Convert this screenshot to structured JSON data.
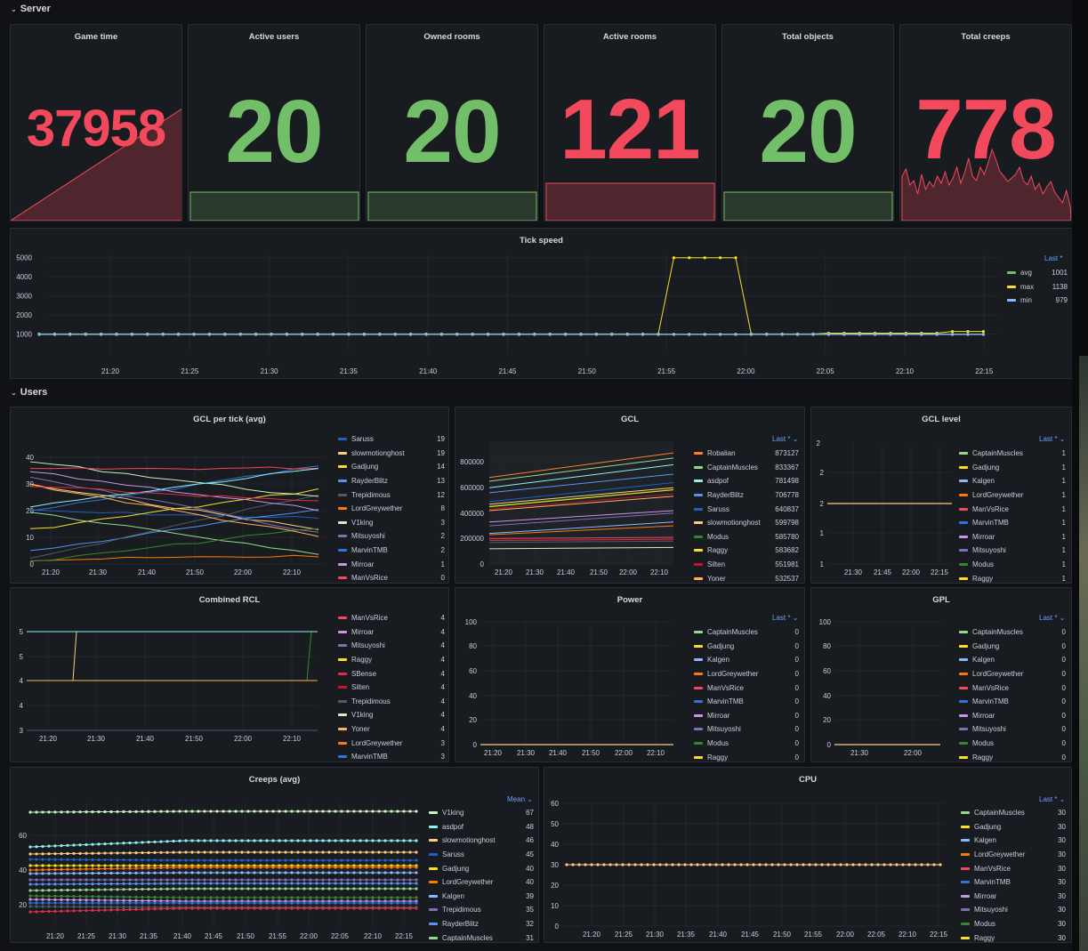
{
  "rows": {
    "server": "Server",
    "users": "Users"
  },
  "colors": {
    "red": "#f2495c",
    "green": "#73bf69",
    "bg": "#181b1f"
  },
  "stats": [
    {
      "title": "Game time",
      "value": "37958",
      "color": "red"
    },
    {
      "title": "Active users",
      "value": "20",
      "color": "green"
    },
    {
      "title": "Owned rooms",
      "value": "20",
      "color": "green"
    },
    {
      "title": "Active rooms",
      "value": "121",
      "color": "red"
    },
    {
      "title": "Total objects",
      "value": "20",
      "color": "green"
    },
    {
      "title": "Total creeps",
      "value": "778",
      "color": "red"
    }
  ],
  "panels": {
    "tick": "Tick speed",
    "gcl_tick": "GCL per tick (avg)",
    "gcl": "GCL",
    "gcl_level": "GCL level",
    "rcl": "Combined RCL",
    "power": "Power",
    "gpl": "GPL",
    "creeps": "Creeps (avg)",
    "cpu": "CPU"
  },
  "legend_headers": {
    "last": "Last *",
    "mean": "Mean"
  },
  "legends": {
    "tick": [
      [
        "avg",
        "1001",
        "#73bf69"
      ],
      [
        "max",
        "1138",
        "#fade2a"
      ],
      [
        "min",
        "979",
        "#8ab8ff"
      ]
    ],
    "gcl_tick": [
      [
        "Saruss",
        "19",
        "#1f60c4"
      ],
      [
        "slowmotionghost",
        "19",
        "#ffcb7d"
      ],
      [
        "Gadjung",
        "14",
        "#fade2a"
      ],
      [
        "RayderBlitz",
        "13",
        "#5794f2"
      ],
      [
        "Trepidimous",
        "12",
        "#4f5a6b"
      ],
      [
        "LordGreywether",
        "8",
        "#ff780a"
      ],
      [
        "V1king",
        "3",
        "#c8f2c2"
      ],
      [
        "Mitsuyoshi",
        "2",
        "#806eb7"
      ],
      [
        "MarvinTMB",
        "2",
        "#3274d9"
      ],
      [
        "Mirroar",
        "1",
        "#ca95e5"
      ],
      [
        "ManVsRice",
        "0",
        "#f2495c"
      ]
    ],
    "gcl": [
      [
        "Robalian",
        "873127",
        "#ff7f2a"
      ],
      [
        "CaptainMuscles",
        "833367",
        "#96d98d"
      ],
      [
        "asdpof",
        "781498",
        "#8ff0f2"
      ],
      [
        "RayderBlitz",
        "706778",
        "#5794f2"
      ],
      [
        "Saruss",
        "640837",
        "#1f60c4"
      ],
      [
        "slowmotionghost",
        "599798",
        "#ffcb7d"
      ],
      [
        "Modus",
        "585780",
        "#37872d"
      ],
      [
        "Raggy",
        "583682",
        "#fade2a"
      ],
      [
        "Silten",
        "551981",
        "#c4162a"
      ],
      [
        "Yoner",
        "532537",
        "#ffb357"
      ]
    ],
    "gcl_level": [
      [
        "CaptainMuscles",
        "1",
        "#96d98d"
      ],
      [
        "Gadjung",
        "1",
        "#fade2a"
      ],
      [
        "Kalgen",
        "1",
        "#8ab8ff"
      ],
      [
        "LordGreywether",
        "1",
        "#ff780a"
      ],
      [
        "ManVsRice",
        "1",
        "#f2495c"
      ],
      [
        "MarvinTMB",
        "1",
        "#3274d9"
      ],
      [
        "Mirroar",
        "1",
        "#ca95e5"
      ],
      [
        "Mitsuyoshi",
        "1",
        "#806eb7"
      ],
      [
        "Modus",
        "1",
        "#37872d"
      ],
      [
        "Raggy",
        "1",
        "#fade2a"
      ]
    ],
    "rcl": [
      [
        "ManVsRice",
        "4",
        "#f2495c"
      ],
      [
        "Mirroar",
        "4",
        "#ca95e5"
      ],
      [
        "Mitsuyoshi",
        "4",
        "#806eb7"
      ],
      [
        "Raggy",
        "4",
        "#fade2a"
      ],
      [
        "SBense",
        "4",
        "#e02f44"
      ],
      [
        "Silten",
        "4",
        "#c4162a"
      ],
      [
        "Trepidimous",
        "4",
        "#4f5a6b"
      ],
      [
        "V1king",
        "4",
        "#c8f2c2"
      ],
      [
        "Yoner",
        "4",
        "#ffb357"
      ],
      [
        "LordGreywether",
        "3",
        "#ff780a"
      ],
      [
        "MarvinTMB",
        "3",
        "#3274d9"
      ]
    ],
    "power": [
      [
        "CaptainMuscles",
        "0",
        "#96d98d"
      ],
      [
        "Gadjung",
        "0",
        "#fade2a"
      ],
      [
        "Kalgen",
        "0",
        "#8ab8ff"
      ],
      [
        "LordGreywether",
        "0",
        "#ff780a"
      ],
      [
        "ManVsRice",
        "0",
        "#f2495c"
      ],
      [
        "MarvinTMB",
        "0",
        "#3274d9"
      ],
      [
        "Mirroar",
        "0",
        "#ca95e5"
      ],
      [
        "Mitsuyoshi",
        "0",
        "#806eb7"
      ],
      [
        "Modus",
        "0",
        "#37872d"
      ],
      [
        "Raggy",
        "0",
        "#fade2a"
      ]
    ],
    "gpl": [
      [
        "CaptainMuscles",
        "0",
        "#96d98d"
      ],
      [
        "Gadjung",
        "0",
        "#fade2a"
      ],
      [
        "Kalgen",
        "0",
        "#8ab8ff"
      ],
      [
        "LordGreywether",
        "0",
        "#ff780a"
      ],
      [
        "ManVsRice",
        "0",
        "#f2495c"
      ],
      [
        "MarvinTMB",
        "0",
        "#3274d9"
      ],
      [
        "Mirroar",
        "0",
        "#ca95e5"
      ],
      [
        "Mitsuyoshi",
        "0",
        "#806eb7"
      ],
      [
        "Modus",
        "0",
        "#37872d"
      ],
      [
        "Raggy",
        "0",
        "#fade2a"
      ]
    ],
    "creeps": [
      [
        "V1king",
        "67",
        "#c8f2c2"
      ],
      [
        "asdpof",
        "48",
        "#8ff0f2"
      ],
      [
        "slowmotionghost",
        "46",
        "#ffcb7d"
      ],
      [
        "Saruss",
        "45",
        "#1f60c4"
      ],
      [
        "Gadjung",
        "40",
        "#fade2a"
      ],
      [
        "LordGreywether",
        "40",
        "#ff780a"
      ],
      [
        "Kalgen",
        "39",
        "#8ab8ff"
      ],
      [
        "Trepidimous",
        "35",
        "#806eb7"
      ],
      [
        "RayderBlitz",
        "32",
        "#5794f2"
      ],
      [
        "CaptainMuscles",
        "31",
        "#96d98d"
      ]
    ],
    "cpu": [
      [
        "CaptainMuscles",
        "30",
        "#96d98d"
      ],
      [
        "Gadjung",
        "30",
        "#fade2a"
      ],
      [
        "Kalgen",
        "30",
        "#8ab8ff"
      ],
      [
        "LordGreywether",
        "30",
        "#ff780a"
      ],
      [
        "ManVsRice",
        "30",
        "#f2495c"
      ],
      [
        "MarvinTMB",
        "30",
        "#3274d9"
      ],
      [
        "Mirroar",
        "30",
        "#ca95e5"
      ],
      [
        "Mitsuyoshi",
        "30",
        "#806eb7"
      ],
      [
        "Modus",
        "30",
        "#37872d"
      ],
      [
        "Raggy",
        "30",
        "#fade2a"
      ]
    ]
  },
  "chart_data": [
    {
      "type": "line",
      "title": "Tick speed",
      "x": [
        "21:20",
        "21:25",
        "21:30",
        "21:35",
        "21:40",
        "21:45",
        "21:50",
        "21:55",
        "22:00",
        "22:05",
        "22:10",
        "22:15"
      ],
      "ylim": [
        0,
        5500
      ],
      "yticks": [
        1000,
        2000,
        3000,
        4000,
        5000
      ],
      "series": [
        {
          "name": "avg",
          "values": [
            1000,
            1000,
            1000,
            1000,
            1000,
            1000,
            1000,
            1000,
            1000,
            1000,
            1000,
            1001
          ]
        },
        {
          "name": "max",
          "values": [
            1020,
            1020,
            1010,
            1010,
            1010,
            1010,
            1010,
            5000,
            1010,
            1060,
            1060,
            1138
          ]
        },
        {
          "name": "min",
          "values": [
            979,
            979,
            979,
            979,
            979,
            979,
            979,
            979,
            979,
            979,
            979,
            979
          ]
        }
      ]
    },
    {
      "type": "line",
      "title": "GCL per tick (avg)",
      "x": [
        "21:20",
        "21:30",
        "21:40",
        "21:50",
        "22:00",
        "22:10"
      ],
      "yticks": [
        0,
        10,
        20,
        30,
        40
      ]
    },
    {
      "type": "line",
      "title": "GCL",
      "x": [
        "21:20",
        "21:30",
        "21:40",
        "21:50",
        "22:00",
        "22:10"
      ],
      "yticks": [
        0,
        200000,
        400000,
        600000,
        800000
      ]
    },
    {
      "type": "line",
      "title": "GCL level",
      "x": [
        "21:30",
        "21:45",
        "22:00",
        "22:15"
      ],
      "yticks": [
        1,
        1,
        2,
        2
      ],
      "values": [
        1,
        1,
        1,
        1
      ]
    },
    {
      "type": "line",
      "title": "Combined RCL",
      "x": [
        "21:20",
        "21:30",
        "21:40",
        "21:50",
        "22:00",
        "22:10"
      ],
      "yticks": [
        3,
        4,
        4,
        5,
        5
      ]
    },
    {
      "type": "line",
      "title": "Power",
      "x": [
        "21:20",
        "21:30",
        "21:40",
        "21:50",
        "22:00",
        "22:10"
      ],
      "yticks": [
        0,
        20,
        40,
        60,
        80,
        100
      ],
      "values": [
        0,
        0,
        0,
        0,
        0,
        0
      ]
    },
    {
      "type": "line",
      "title": "GPL",
      "x": [
        "21:30",
        "22:00"
      ],
      "yticks": [
        0,
        20,
        40,
        60,
        80,
        100
      ],
      "values": [
        0,
        0
      ]
    },
    {
      "type": "line",
      "title": "Creeps (avg)",
      "x": [
        "21:20",
        "21:25",
        "21:30",
        "21:35",
        "21:40",
        "21:45",
        "21:50",
        "21:55",
        "22:00",
        "22:05",
        "22:10",
        "22:15"
      ],
      "yticks": [
        20,
        40,
        60
      ]
    },
    {
      "type": "line",
      "title": "CPU",
      "x": [
        "21:20",
        "21:25",
        "21:30",
        "21:35",
        "21:40",
        "21:45",
        "21:50",
        "21:55",
        "22:00",
        "22:05",
        "22:10",
        "22:15"
      ],
      "yticks": [
        0,
        10,
        20,
        30,
        40,
        50,
        60
      ],
      "values": [
        30,
        30,
        30,
        30,
        30,
        30,
        30,
        30,
        30,
        30,
        30,
        30
      ]
    }
  ]
}
